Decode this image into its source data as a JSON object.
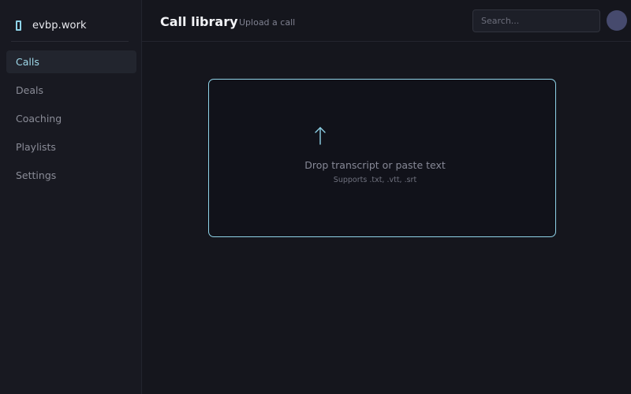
{
  "brand": {
    "name": "evbp.work",
    "icon": "book-icon"
  },
  "sidebar": {
    "items": [
      {
        "label": "Calls",
        "active": true
      },
      {
        "label": "Deals",
        "active": false
      },
      {
        "label": "Coaching",
        "active": false
      },
      {
        "label": "Playlists",
        "active": false
      },
      {
        "label": "Settings",
        "active": false
      }
    ]
  },
  "header": {
    "title": "Call library",
    "subtitle": "Upload a call"
  },
  "search": {
    "placeholder": "Search..."
  },
  "dropzone": {
    "icon": "upload-arrow-icon",
    "title": "Drop transcript or paste text",
    "hint": "Supports .txt, .vtt, .srt"
  },
  "colors": {
    "accent": "#8fd3e8",
    "avatar": "#464a6d",
    "background": "#15161d"
  }
}
